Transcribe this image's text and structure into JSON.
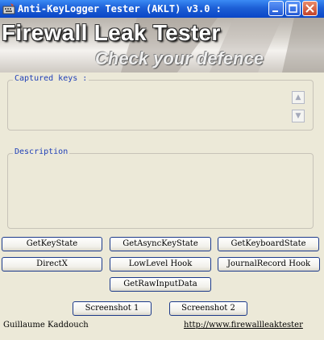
{
  "window": {
    "title": "Anti-KeyLogger Tester (AKLT) v3.0 :"
  },
  "banner": {
    "title": "Firewall Leak Tester",
    "subtitle": "Check your defence"
  },
  "captured_keys": {
    "legend": "Captured keys :"
  },
  "description": {
    "legend": "Description"
  },
  "buttons": {
    "get_key_state": "GetKeyState",
    "get_async_key_state": "GetAsyncKeyState",
    "get_keyboard_state": "GetKeyboardState",
    "directx": "DirectX",
    "lowlevel_hook": "LowLevel Hook",
    "journalrecord_hook": "JournalRecord Hook",
    "get_raw_input_data": "GetRawInputData",
    "screenshot_1": "Screenshot 1",
    "screenshot_2": "Screenshot 2"
  },
  "footer": {
    "author": "Guillaume Kaddouch",
    "url": "http://www.firewallleaktester"
  },
  "scroll": {
    "up_glyph": "▲",
    "down_glyph": "▼"
  },
  "colors": {
    "titlebar": "#0a46c6",
    "legend": "#1f3fb7",
    "window_bg": "#ece9d8"
  }
}
